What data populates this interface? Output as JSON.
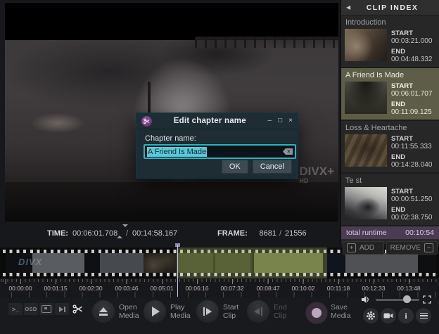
{
  "panel": {
    "header": "CLIP INDEX",
    "collapse_glyph": "◀",
    "start_label": "START",
    "end_label": "END",
    "chapters": [
      {
        "name": "Introduction",
        "start": "00:03:21.000",
        "end": "00:04:48.332"
      },
      {
        "name": "A Friend Is Made",
        "start": "00:06:01.707",
        "end": "00:11:09.125"
      },
      {
        "name": "Loss & Heartache",
        "start": "00:11:55.333",
        "end": "00:14:28.040"
      },
      {
        "name": "Te st",
        "start": "00:00:51.250",
        "end": "00:02:38.750"
      }
    ],
    "total_runtime_label": "total runtime",
    "total_runtime": "00:10:54",
    "add_label": "ADD",
    "remove_label": "REMOVE",
    "plus_glyph": "+",
    "minus_glyph": "−"
  },
  "dialog": {
    "title": "Edit chapter name",
    "field_label": "Chapter name:",
    "field_value": "A Friend Is Made",
    "ok_label": "OK",
    "cancel_label": "Cancel",
    "minimize_glyph": "–",
    "maximize_glyph": "□",
    "close_glyph": "×"
  },
  "status": {
    "time_label": "TIME:",
    "time_current": "00:06:01.708",
    "separator": "/",
    "time_total": "00:14:58.167",
    "frame_label": "FRAME:",
    "frame_current": "8681",
    "frame_total": "21556"
  },
  "video": {
    "watermark_line1": "DIVX+",
    "watermark_line2": "HD"
  },
  "timeline": {
    "logo": "DIVX",
    "ticks": [
      "00:00:00",
      "00:01:15",
      "00:02:30",
      "00:03:46",
      "00:05:01",
      "00:06:16",
      "00:07:32",
      "00:08:47",
      "00:10:02",
      "00:11:18",
      "00:12:33",
      "00:13:48"
    ]
  },
  "toolbar": {
    "terminal_glyph": ">_",
    "osd_label": "OSD"
  },
  "transport": {
    "open_line1": "Open",
    "open_line2": "Media",
    "play_line1": "Play",
    "play_line2": "Media",
    "start_line1": "Start",
    "start_line2": "Clip",
    "end_line1": "End",
    "end_line2": "Clip",
    "save_line1": "Save",
    "save_line2": "Media"
  },
  "colors": {
    "accent_cyan": "#2ab3c4",
    "selection_highlight": "#5ac8d8",
    "selected_chapter_olive": "#5e5e48",
    "runtime_purple": "#4a3c52",
    "clip_overlay_green": "rgba(152,170,90,0.35)"
  }
}
